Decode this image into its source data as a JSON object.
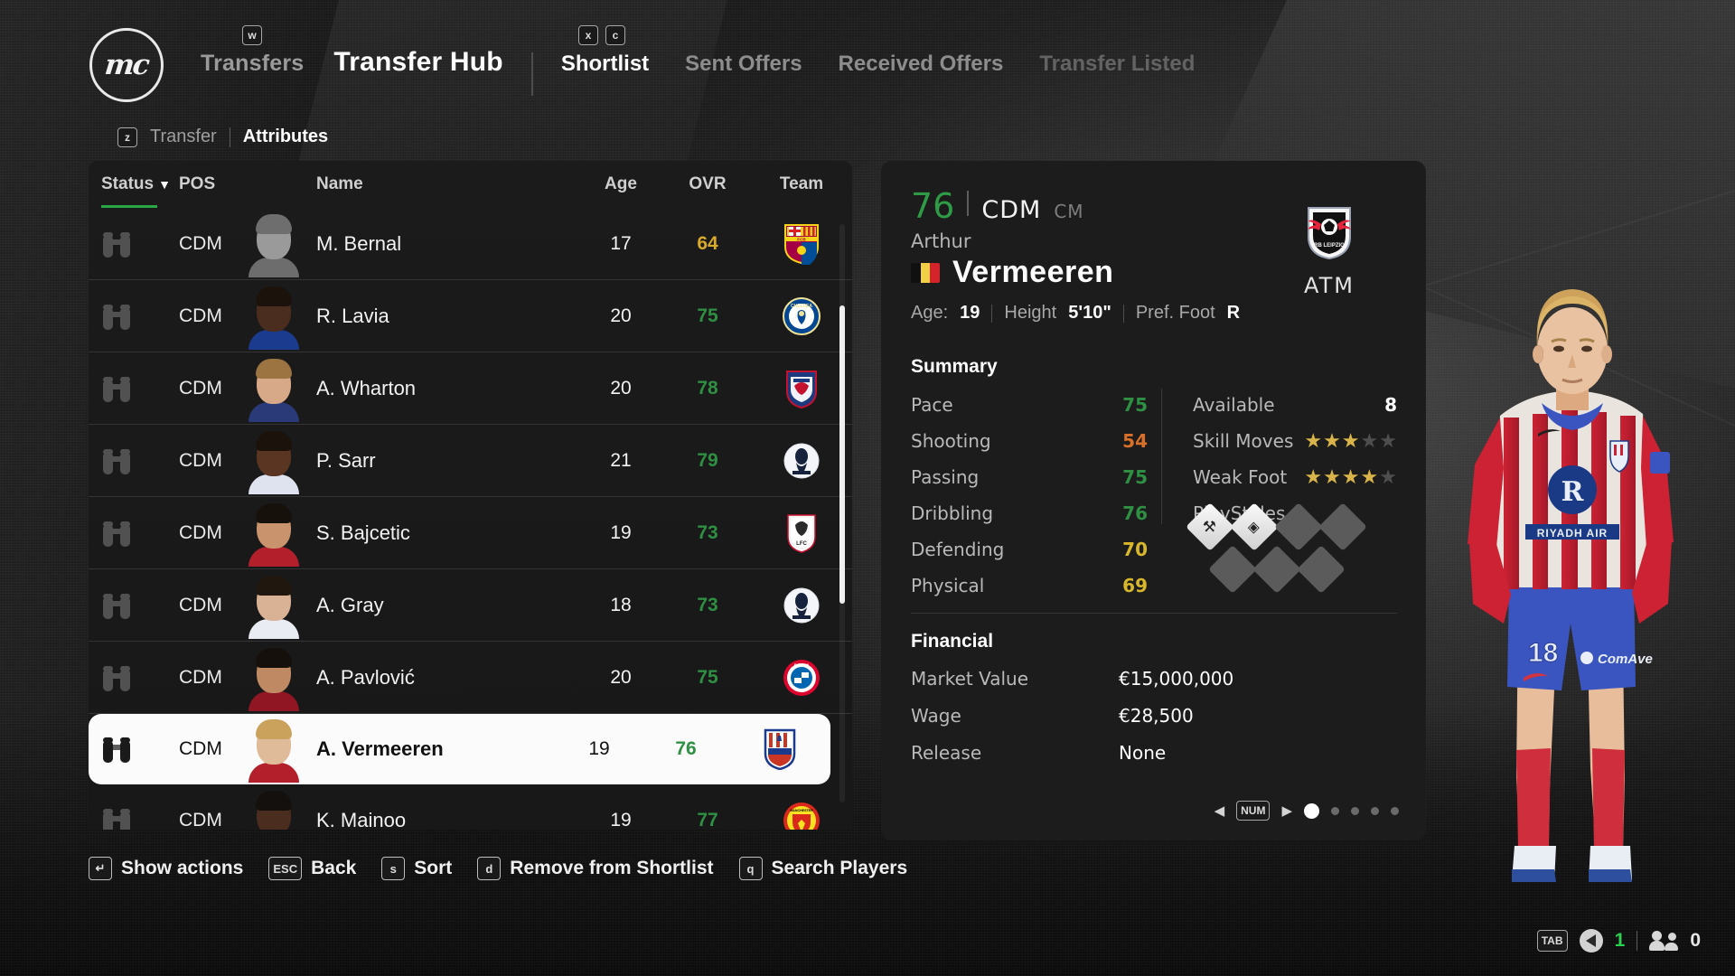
{
  "app": {
    "logo_text": "mc"
  },
  "header": {
    "nav": [
      {
        "label": "Transfers",
        "active": false,
        "key": "w"
      },
      {
        "label": "Transfer Hub",
        "active": true
      }
    ],
    "tabs": [
      {
        "label": "Shortlist",
        "state": "active",
        "key": "x"
      },
      {
        "label": "Sent Offers",
        "state": "normal",
        "key": "c"
      },
      {
        "label": "Received Offers",
        "state": "normal"
      },
      {
        "label": "Transfer Listed",
        "state": "dim"
      }
    ],
    "subtabs": {
      "key": "z",
      "items": [
        {
          "label": "Transfer",
          "active": false
        },
        {
          "label": "Attributes",
          "active": true
        }
      ]
    }
  },
  "list": {
    "columns": [
      "Status",
      "POS",
      "Name",
      "Age",
      "OVR",
      "Team"
    ],
    "sort_arrow": "▼",
    "rows": [
      {
        "pos": "CDM",
        "name": "M. Bernal",
        "age": "17",
        "ovr": "64",
        "ovr_color": "#d8a92a",
        "team": "FCB",
        "crest": "barcelona",
        "selected": false,
        "skin": "#9a9a9a",
        "hair": "#6e6e6e",
        "kit": "#6d6d6d"
      },
      {
        "pos": "CDM",
        "name": "R. Lavia",
        "age": "20",
        "ovr": "75",
        "ovr_color": "#2f8f43",
        "team": "CHE",
        "crest": "chelsea",
        "selected": false,
        "skin": "#4a2d1e",
        "hair": "#1b120c",
        "kit": "#1b3b8f"
      },
      {
        "pos": "CDM",
        "name": "A. Wharton",
        "age": "20",
        "ovr": "78",
        "ovr_color": "#2f8f43",
        "team": "CRY",
        "crest": "palace",
        "selected": false,
        "skin": "#d7a988",
        "hair": "#9c7441",
        "kit": "#2a3a78"
      },
      {
        "pos": "CDM",
        "name": "P. Sarr",
        "age": "21",
        "ovr": "79",
        "ovr_color": "#2f8f43",
        "team": "TOT",
        "crest": "tottenham",
        "selected": false,
        "skin": "#5a3622",
        "hair": "#1b120c",
        "kit": "#dfe3ef"
      },
      {
        "pos": "CDM",
        "name": "S. Bajcetic",
        "age": "19",
        "ovr": "73",
        "ovr_color": "#2f8f43",
        "team": "LIV",
        "crest": "liverpool",
        "selected": false,
        "skin": "#c9936d",
        "hair": "#17110c",
        "kit": "#b3202c"
      },
      {
        "pos": "CDM",
        "name": "A. Gray",
        "age": "18",
        "ovr": "73",
        "ovr_color": "#2f8f43",
        "team": "TOT",
        "crest": "tottenham",
        "selected": false,
        "skin": "#d9b194",
        "hair": "#20170f",
        "kit": "#e9ecf3"
      },
      {
        "pos": "CDM",
        "name": "A. Pavlović",
        "age": "20",
        "ovr": "75",
        "ovr_color": "#2f8f43",
        "team": "FCB",
        "crest": "bayern",
        "selected": false,
        "skin": "#bf8a63",
        "hair": "#15100b",
        "kit": "#8f1622"
      },
      {
        "pos": "CDM",
        "name": "A. Vermeeren",
        "age": "19",
        "ovr": "76",
        "ovr_color": "#2f8f43",
        "team": "ATM",
        "crest": "atletico",
        "selected": true,
        "skin": "#e0bb99",
        "hair": "#caa25c",
        "kit": "#b3202c"
      },
      {
        "pos": "CDM",
        "name": "K. Mainoo",
        "age": "19",
        "ovr": "77",
        "ovr_color": "#2f8f43",
        "team": "MUN",
        "crest": "manutd",
        "selected": false,
        "skin": "#4a2d1e",
        "hair": "#13100d",
        "kit": "#b3202c"
      }
    ]
  },
  "actions": [
    {
      "key": "↵",
      "label": "Show actions"
    },
    {
      "key": "ESC",
      "label": "Back"
    },
    {
      "key": "s",
      "label": "Sort"
    },
    {
      "key": "d",
      "label": "Remove from Shortlist"
    },
    {
      "key": "q",
      "label": "Search Players"
    }
  ],
  "detail": {
    "ovr": "76",
    "position": "CDM",
    "alt_position": "CM",
    "first_name": "Arthur",
    "last_name": "Vermeeren",
    "nationality": "Belgium",
    "meta": [
      {
        "key": "Age:",
        "value": "19"
      },
      {
        "key": "Height",
        "value": "5'10\""
      },
      {
        "key": "Pref. Foot",
        "value": "R"
      }
    ],
    "club_abbr": "ATM",
    "club_badge": "rb-leipzig",
    "summary_title": "Summary",
    "attributes": [
      {
        "label": "Pace",
        "value": "75",
        "color": "#2f8f43"
      },
      {
        "label": "Shooting",
        "value": "54",
        "color": "#d9702a"
      },
      {
        "label": "Passing",
        "value": "75",
        "color": "#2f8f43"
      },
      {
        "label": "Dribbling",
        "value": "76",
        "color": "#2f8f43"
      },
      {
        "label": "Defending",
        "value": "70",
        "color": "#d8b72a"
      },
      {
        "label": "Physical",
        "value": "69",
        "color": "#d8b72a"
      }
    ],
    "available_label": "Available",
    "available_value": "8",
    "skill_moves_label": "Skill Moves",
    "skill_moves": 3,
    "weak_foot_label": "Weak Foot",
    "weak_foot": 4,
    "playstyles_label": "PlayStyles",
    "playstyles": [
      {
        "filled": true,
        "glyph": "⚒"
      },
      {
        "filled": true,
        "glyph": "◈"
      },
      {
        "filled": false,
        "glyph": ""
      },
      {
        "filled": false,
        "glyph": ""
      },
      {
        "filled": false,
        "glyph": ""
      },
      {
        "filled": false,
        "glyph": ""
      },
      {
        "filled": false,
        "glyph": ""
      }
    ],
    "financial_title": "Financial",
    "financial": [
      {
        "label": "Market Value",
        "value": "€15,000,000"
      },
      {
        "label": "Wage",
        "value": "€28,500"
      },
      {
        "label": "Release",
        "value": "None"
      }
    ],
    "pager": {
      "key": "NUM",
      "left_arrow": "◀",
      "right_arrow": "▶",
      "pages": 5,
      "current": 1
    }
  },
  "status_bar": {
    "key": "TAB",
    "volume": "1",
    "players": "0"
  }
}
